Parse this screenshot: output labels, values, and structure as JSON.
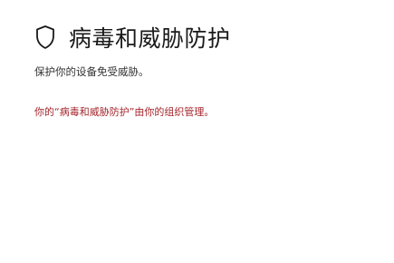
{
  "header": {
    "title": "病毒和威胁防护",
    "icon": "shield-icon"
  },
  "description": "保护你的设备免受威胁。",
  "notice": {
    "text": "你的“病毒和威胁防护”由你的组织管理。",
    "color": "#a4262c"
  }
}
